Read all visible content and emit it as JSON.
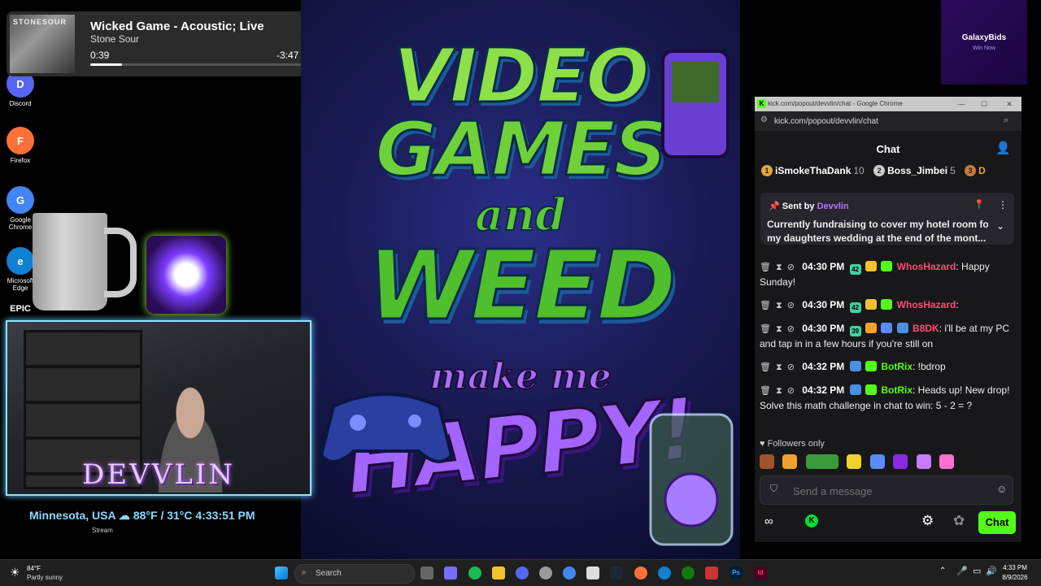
{
  "desktop": {
    "icons": [
      {
        "label": "Discord",
        "color": "#5865f2",
        "glyph": "D"
      },
      {
        "label": "Firefox",
        "color": "#ff7139",
        "glyph": "F"
      },
      {
        "label": "Google Chrome",
        "color": "#4285f4",
        "glyph": "G"
      },
      {
        "label": "Microsoft Edge",
        "color": "#0f7fd1",
        "glyph": "e"
      },
      {
        "label": "EPIC",
        "color": "#111111",
        "glyph": "E"
      }
    ]
  },
  "media": {
    "album_text": "STONESOUR",
    "title": "Wicked Game - Acoustic; Live",
    "artist": "Stone Sour",
    "elapsed": "0:39",
    "remaining": "-3:47",
    "progress": 0.15
  },
  "poster": {
    "line1": "VIDEO",
    "line2": "GAMES",
    "line3": "and",
    "line4": "WEED",
    "line5": "make me",
    "line6": "HAPPY!"
  },
  "ad": {
    "name": "GalaxyBids",
    "sub": "Win Now"
  },
  "chrome": {
    "title": "kick.com/popout/devvlin/chat - Google Chrome",
    "url": "kick.com/popout/devvlin/chat",
    "icon": "K"
  },
  "chat": {
    "header": "Chat",
    "leaderboard": [
      {
        "rank": "1",
        "name": "iSmokeThaDank",
        "points": "10"
      },
      {
        "rank": "2",
        "name": "Boss_Jimbei",
        "points": "5"
      },
      {
        "rank": "3",
        "name": "D",
        "points": ""
      }
    ],
    "pinned": {
      "sent_by": "Sent by",
      "user": "Devvlin",
      "line1": "Currently fundraising to cover my hotel room for",
      "line2": "my daughters wedding at the end of the mont..."
    },
    "messages": [
      {
        "time": "04:30 PM",
        "badge": "42",
        "user": "WhosHazard",
        "color": "#ff4d6d",
        "text": ": Happy Sunday!"
      },
      {
        "time": "04:30 PM",
        "badge": "42",
        "user": "WhosHazard",
        "color": "#ff4d6d",
        "text": ":"
      },
      {
        "time": "04:30 PM",
        "badge": "39",
        "user": "B8DK",
        "color": "#ff4d6d",
        "text": ": i'll be at my PC and tap in in a few hours if you're still on"
      },
      {
        "time": "04:32 PM",
        "badge": "",
        "user": "BotRix",
        "color": "#53fc18",
        "text": ": !bdrop"
      },
      {
        "time": "04:32 PM",
        "badge": "",
        "user": "BotRix",
        "color": "#53fc18",
        "text": ": Heads up! New drop! Solve this math challenge in chat to win: 5 - 2 = ?"
      }
    ],
    "followers_only": "Followers only",
    "input_placeholder": "Send a message",
    "send_label": "Chat"
  },
  "stream": {
    "name": "DEVVLIN",
    "weather": "Minnesota, USA ☁ 88°F / 31°C 4:33:51 PM",
    "label": "Stream"
  },
  "taskbar": {
    "temp": "84°F",
    "condition": "Partly sunny",
    "search": "Search",
    "time": "4:33 PM",
    "date": "8/9/2026"
  },
  "colors": {
    "kick_green": "#53fc18",
    "chat_bg": "#18181b",
    "accent_purple": "#b873ff"
  }
}
